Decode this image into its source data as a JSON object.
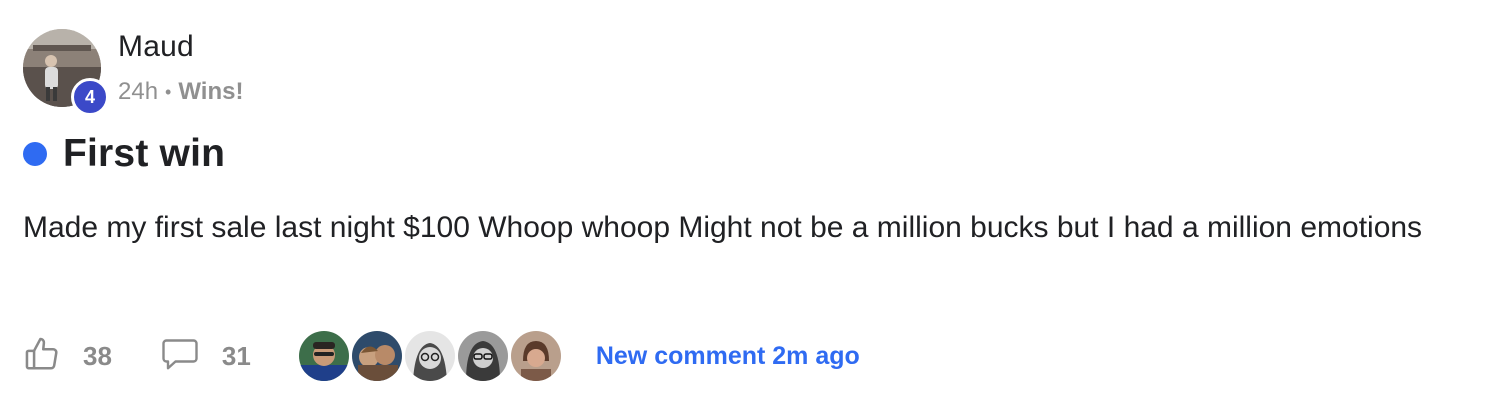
{
  "author": {
    "name": "Maud",
    "level": "4",
    "time": "24h",
    "separator": "•",
    "category": "Wins!"
  },
  "post": {
    "title": "First win",
    "body": "Made my first sale last night $100 Whoop whoop Might not be a million bucks but I had a million emotions",
    "unread_color": "#2f6bf2"
  },
  "footer": {
    "like_icon": "thumbs-up-icon",
    "like_count": "38",
    "comment_icon": "comment-bubble-icon",
    "comment_count": "31",
    "commenter_avatars": [
      "commenter-avatar-1",
      "commenter-avatar-2",
      "commenter-avatar-3",
      "commenter-avatar-4",
      "commenter-avatar-5"
    ],
    "new_comment": "New comment 2m ago"
  },
  "colors": {
    "accent": "#2f6bf2",
    "badge": "#3b49c8",
    "muted": "#909090"
  }
}
